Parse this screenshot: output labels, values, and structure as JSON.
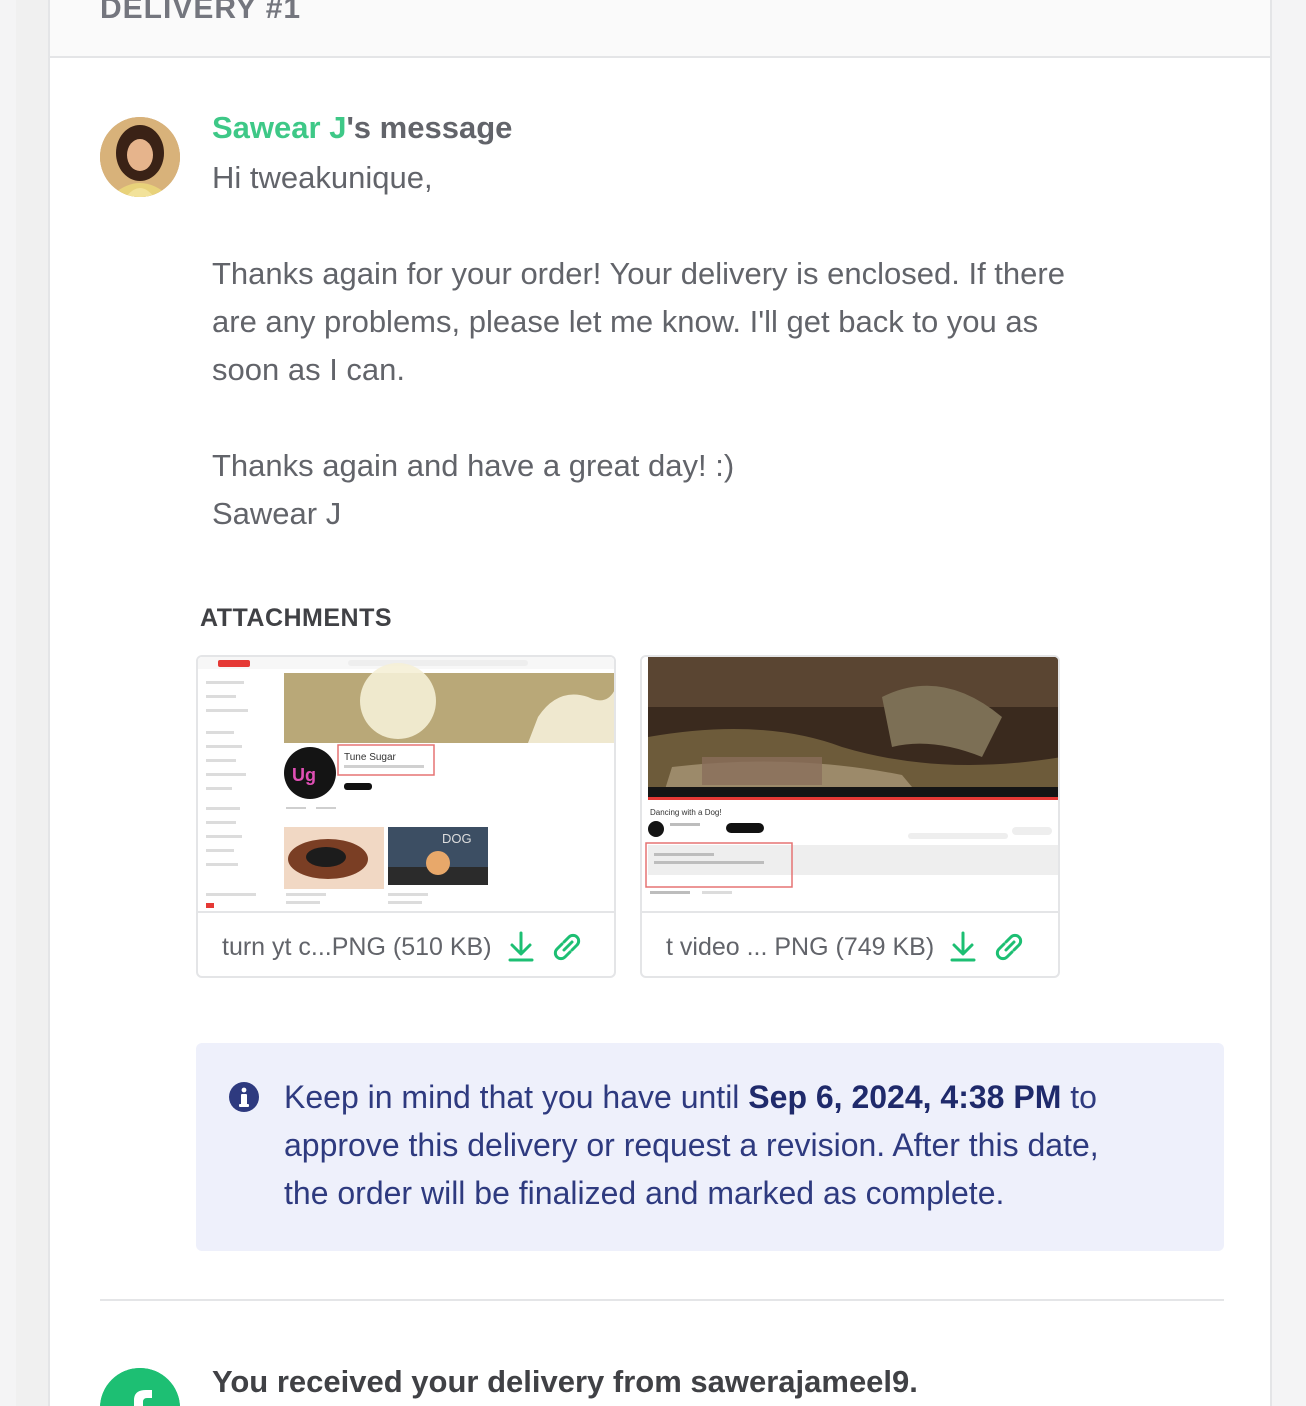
{
  "header": {
    "title": "DELIVERY #1"
  },
  "message": {
    "sender": "Sawear J",
    "heading_suffix": "'s message",
    "lines": [
      "Hi tweakunique,",
      "",
      "Thanks again for your order! Your delivery is enclosed. If there",
      "are any problems, please let me know. I'll get back to you as",
      "soon as I can.",
      "",
      "Thanks again and have a great day! :)",
      "Sawear J"
    ]
  },
  "attachments": {
    "title": "ATTACHMENTS",
    "items": [
      {
        "name": "turn yt c...PNG (510 KB)",
        "thumb_channel": "Tune Sugar",
        "thumb_dog": "DOG"
      },
      {
        "name": "t video ... PNG (749 KB)",
        "thumb_title": "Dancing with a Dog!"
      }
    ]
  },
  "notice": {
    "prefix": "Keep in mind that you have until ",
    "deadline": "Sep 6, 2024, 4:38 PM",
    "suffix_line1": " to",
    "line2": "approve this delivery or request a revision. After this date,",
    "line3": "the order will be finalized and marked as complete."
  },
  "footer": {
    "received_text": "You received your delivery from sawerajameel9."
  },
  "colors": {
    "accent": "#1dbf73",
    "notice_bg": "#eef0fb",
    "notice_text": "#2e3a7f"
  },
  "icons": {
    "download": "download-icon",
    "link": "link-icon",
    "info": "info-icon",
    "delivery": "delivery-badge-icon"
  }
}
